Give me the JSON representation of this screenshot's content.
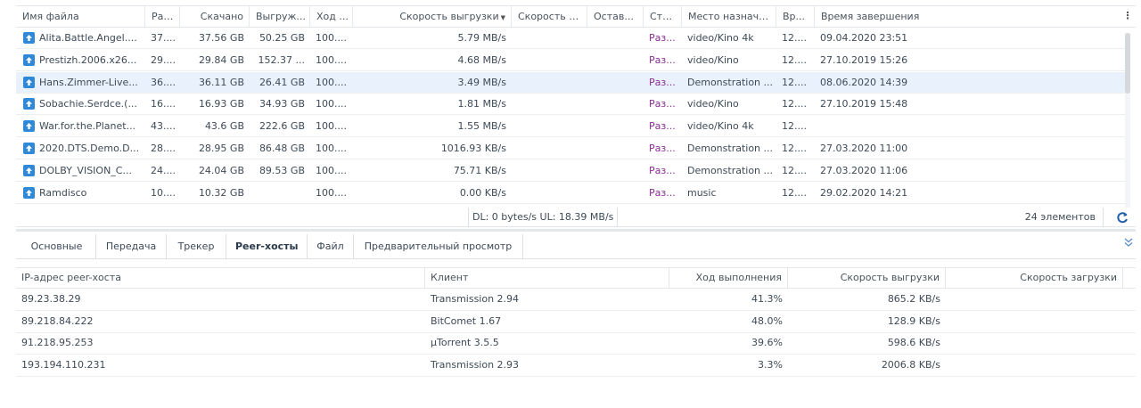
{
  "columns": {
    "name": "Имя файла",
    "size": "Раз...",
    "downloaded": "Скачано",
    "uploaded": "Выгруж...",
    "progress": "Ход ...",
    "upload_speed": "Скорость выгрузки",
    "download_speed": "Скорость з...",
    "remaining": "Остав...",
    "status": "Ста...",
    "destination": "Место назначе...",
    "time": "Вр...",
    "completed": "Время завершения"
  },
  "column_menu_icon": "vertical-ellipsis-icon",
  "sort_icon": "caret-down-icon",
  "file_icon": "upload-arrow-icon",
  "rows": [
    {
      "name": "Alita.Battle.Angel....",
      "size": "37....",
      "downloaded": "37.56 GB",
      "uploaded": "50.25 GB",
      "progress": "100....",
      "upload_speed": "5.79 MB/s",
      "download_speed": "",
      "remaining": "",
      "status": "Раз...",
      "destination": "video/Kino 4k",
      "time": "12....",
      "completed": "09.04.2020 23:51"
    },
    {
      "name": "Prestizh.2006.x26...",
      "size": "29....",
      "downloaded": "29.84 GB",
      "uploaded": "152.37 ...",
      "progress": "100....",
      "upload_speed": "4.68 MB/s",
      "download_speed": "",
      "remaining": "",
      "status": "Раз...",
      "destination": "video/Kino",
      "time": "12....",
      "completed": "27.10.2019 15:26"
    },
    {
      "name": "Hans.Zimmer-Live...",
      "size": "36....",
      "downloaded": "36.11 GB",
      "uploaded": "26.41 GB",
      "progress": "100....",
      "upload_speed": "3.49 MB/s",
      "download_speed": "",
      "remaining": "",
      "status": "Раз...",
      "destination": "Demonstration ...",
      "time": "12....",
      "completed": "08.06.2020 14:39",
      "selected": true
    },
    {
      "name": "Sobachie.Serdce.(...",
      "size": "16....",
      "downloaded": "16.93 GB",
      "uploaded": "34.93 GB",
      "progress": "100....",
      "upload_speed": "1.81 MB/s",
      "download_speed": "",
      "remaining": "",
      "status": "Раз...",
      "destination": "video/Kino",
      "time": "12....",
      "completed": "27.10.2019 15:48"
    },
    {
      "name": "War.for.the.Planet...",
      "size": "43....",
      "downloaded": "43.6 GB",
      "uploaded": "222.6 GB",
      "progress": "100....",
      "upload_speed": "1.55 MB/s",
      "download_speed": "",
      "remaining": "",
      "status": "Раз...",
      "destination": "video/Kino 4k",
      "time": "12....",
      "completed": ""
    },
    {
      "name": "2020.DTS.Demo.D...",
      "size": "28....",
      "downloaded": "28.95 GB",
      "uploaded": "86.48 GB",
      "progress": "100....",
      "upload_speed": "1016.93 KB/s",
      "download_speed": "",
      "remaining": "",
      "status": "Раз...",
      "destination": "Demonstration ...",
      "time": "12....",
      "completed": "27.03.2020 11:00"
    },
    {
      "name": "DOLBY_VISION_C...",
      "size": "24....",
      "downloaded": "24.04 GB",
      "uploaded": "89.53 GB",
      "progress": "100....",
      "upload_speed": "75.71 KB/s",
      "download_speed": "",
      "remaining": "",
      "status": "Раз...",
      "destination": "Demonstration ...",
      "time": "12....",
      "completed": "27.03.2020 11:06"
    },
    {
      "name": "Ramdisco",
      "size": "10....",
      "downloaded": "10.32 GB",
      "uploaded": "",
      "progress": "100....",
      "upload_speed": "0.00 KB/s",
      "download_speed": "",
      "remaining": "",
      "status": "Раз...",
      "destination": "music",
      "time": "12....",
      "completed": "29.02.2020 14:21"
    }
  ],
  "statusbar": {
    "speeds": "DL:  0 bytes/s  UL:  18.39 MB/s",
    "count": "24 элементов",
    "refresh_icon": "refresh-icon"
  },
  "tabs": [
    {
      "label": "Основные"
    },
    {
      "label": "Передача"
    },
    {
      "label": "Трекер"
    },
    {
      "label": "Peer-хосты",
      "active": true
    },
    {
      "label": "Файл"
    },
    {
      "label": "Предварительный просмотр"
    }
  ],
  "collapse_icon": "double-chevron-down-icon",
  "peers": {
    "columns": {
      "ip": "IP-адрес peer-хоста",
      "client": "Клиент",
      "progress": "Ход выполнения",
      "upload": "Скорость выгрузки",
      "download": "Скорость загрузки"
    },
    "rows": [
      {
        "ip": "89.23.38.29",
        "client": "Transmission 2.94",
        "progress": "41.3%",
        "upload": "865.2 KB/s",
        "download": ""
      },
      {
        "ip": "89.218.84.222",
        "client": "BitComet 1.67",
        "progress": "48.0%",
        "upload": "128.9 KB/s",
        "download": ""
      },
      {
        "ip": "91.218.95.253",
        "client": "µTorrent 3.5.5",
        "progress": "39.6%",
        "upload": "598.6 KB/s",
        "download": ""
      },
      {
        "ip": "193.194.110.231",
        "client": "Transmission 2.93",
        "progress": "3.3%",
        "upload": "2006.8 KB/s",
        "download": ""
      }
    ]
  }
}
